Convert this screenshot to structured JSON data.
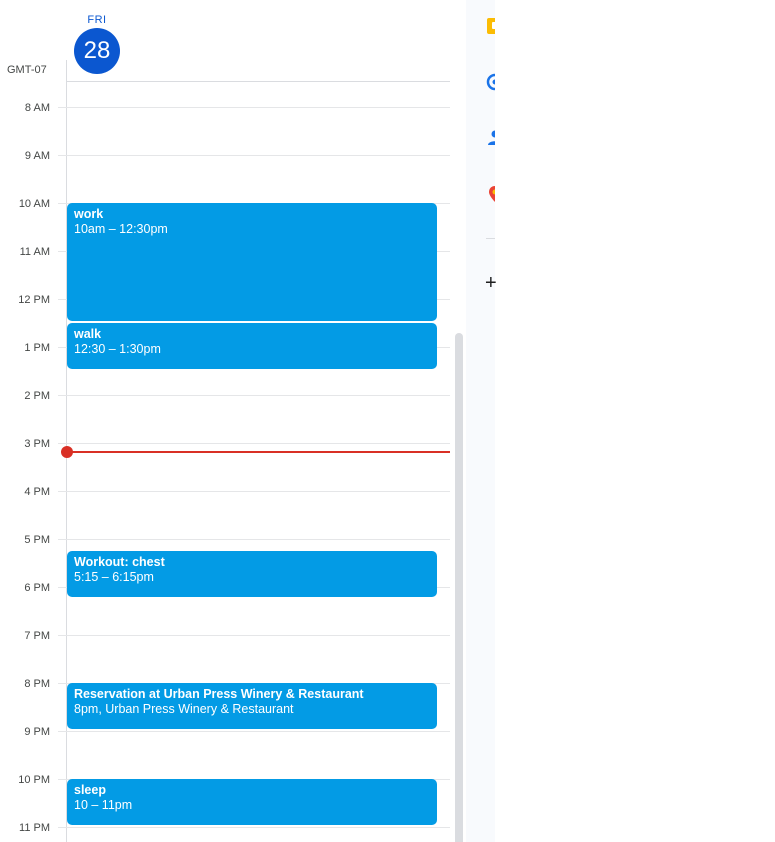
{
  "day_header": {
    "weekday": "FRI",
    "date": "28"
  },
  "timezone": "GMT-07",
  "hours": [
    "8 AM",
    "9 AM",
    "10 AM",
    "11 AM",
    "12 PM",
    "1 PM",
    "2 PM",
    "3 PM",
    "4 PM",
    "5 PM",
    "6 PM",
    "7 PM",
    "8 PM",
    "9 PM",
    "10 PM",
    "11 PM"
  ],
  "events": [
    {
      "title": "work",
      "detail": "10am – 12:30pm"
    },
    {
      "title": "walk",
      "detail": "12:30 – 1:30pm"
    },
    {
      "title": "Workout: chest",
      "detail": "5:15 – 6:15pm"
    },
    {
      "title": "Reservation at Urban Press Winery & Restaurant",
      "detail": "8pm, Urban Press Winery & Restaurant"
    },
    {
      "title": "sleep",
      "detail": "10 – 11pm"
    }
  ],
  "colors": {
    "event": "#039be5",
    "today": "#0b57d0",
    "now_line": "#d93025"
  },
  "side_panel": {
    "icons": [
      "keep-icon",
      "tasks-icon",
      "contacts-icon",
      "maps-icon"
    ],
    "add_label": "+"
  }
}
